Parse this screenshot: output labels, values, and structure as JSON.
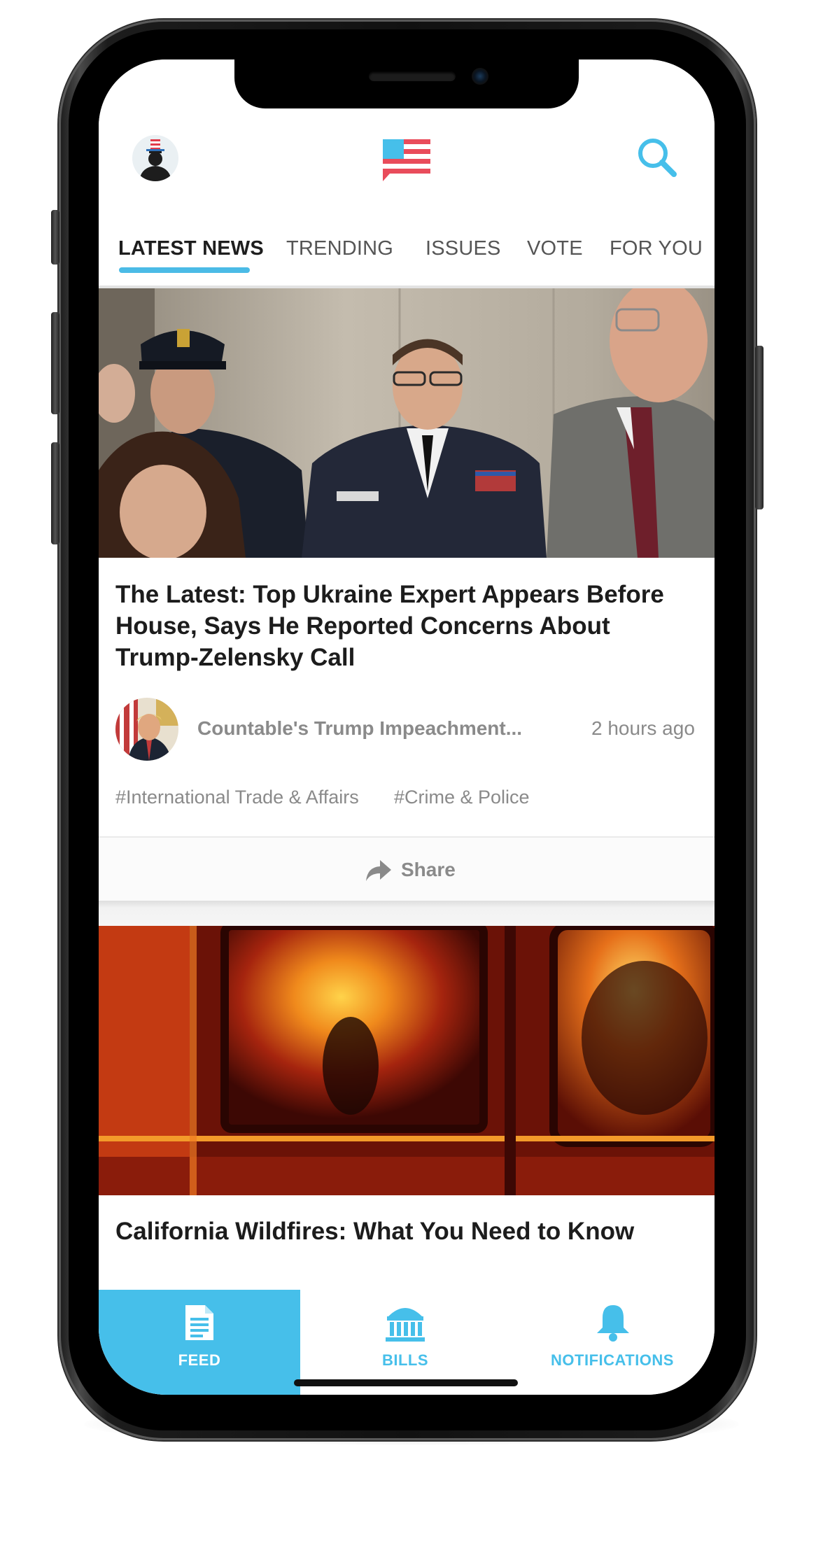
{
  "header": {
    "profile_icon": "uncle-sam-avatar-icon",
    "logo_icon": "us-flag-icon",
    "search_icon": "search-icon"
  },
  "tabs": [
    {
      "label": "LATEST NEWS",
      "active": true
    },
    {
      "label": "TRENDING",
      "active": false
    },
    {
      "label": "ISSUES",
      "active": false
    },
    {
      "label": "VOTE",
      "active": false
    },
    {
      "label": "FOR YOU",
      "active": false
    }
  ],
  "feed": {
    "cards": [
      {
        "headline": "The Latest: Top Ukraine Expert Appears Before House, Says He Reported Concerns About Trump-Zelensky Call",
        "source": "Countable's Trump Impeachment...",
        "time": "2 hours ago",
        "tags": [
          "#International Trade & Affairs",
          "#Crime & Police"
        ],
        "share_label": "Share"
      },
      {
        "headline": "California Wildfires: What You Need to Know"
      }
    ]
  },
  "bottom_nav": [
    {
      "label": "FEED",
      "icon": "document-icon",
      "active": true
    },
    {
      "label": "BILLS",
      "icon": "capitol-building-icon",
      "active": false
    },
    {
      "label": "NOTIFICATIONS",
      "icon": "bell-icon",
      "active": false
    }
  ],
  "colors": {
    "accent": "#46bfea",
    "text_primary": "#1c1c1c",
    "text_secondary": "#8a8a8a"
  }
}
